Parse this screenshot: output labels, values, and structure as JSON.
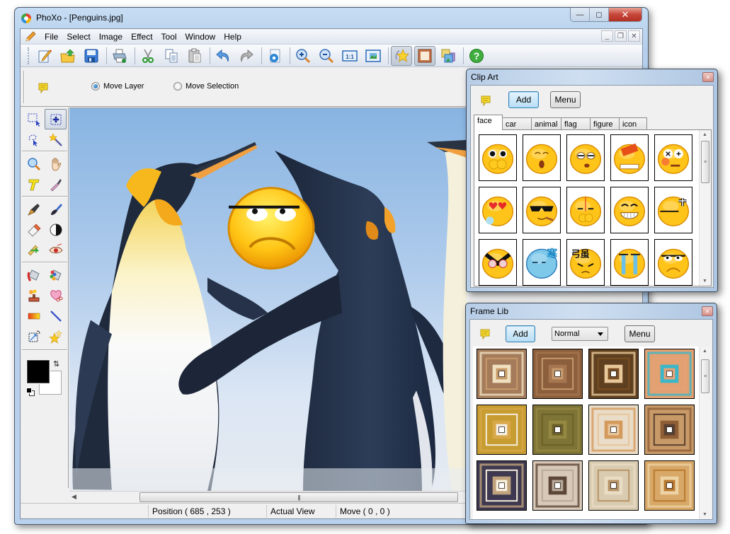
{
  "window": {
    "title": "PhoXo - [Penguins.jpg]",
    "caption": {
      "minimize": "—",
      "maximize": "◻",
      "close": "✕"
    },
    "mdi": {
      "minimize": "_",
      "restore": "❐",
      "close": "✕"
    }
  },
  "menubar": {
    "items": [
      {
        "label": "File"
      },
      {
        "label": "Select"
      },
      {
        "label": "Image"
      },
      {
        "label": "Effect"
      },
      {
        "label": "Tool"
      },
      {
        "label": "Window"
      },
      {
        "label": "Help"
      }
    ]
  },
  "toolbar": {
    "buttons": [
      {
        "name": "new",
        "icon": "new-document-icon"
      },
      {
        "name": "open",
        "icon": "open-folder-icon"
      },
      {
        "name": "save",
        "icon": "save-icon"
      },
      {
        "name": "print",
        "icon": "print-icon"
      },
      {
        "name": "cut",
        "icon": "cut-icon"
      },
      {
        "name": "copy",
        "icon": "copy-icon"
      },
      {
        "name": "paste",
        "icon": "paste-icon"
      },
      {
        "name": "undo",
        "icon": "undo-icon"
      },
      {
        "name": "redo",
        "icon": "redo-icon"
      },
      {
        "name": "settings",
        "icon": "document-settings-icon"
      },
      {
        "name": "zoom-in",
        "icon": "zoom-in-icon"
      },
      {
        "name": "zoom-out",
        "icon": "zoom-out-icon"
      },
      {
        "name": "actual-size",
        "icon": "actual-size-icon",
        "text": "1:1"
      },
      {
        "name": "fit-window",
        "icon": "fit-window-icon"
      },
      {
        "name": "clip-art",
        "icon": "clip-art-star-icon",
        "active": true
      },
      {
        "name": "frame-lib",
        "icon": "frame-icon",
        "active": true
      },
      {
        "name": "layers",
        "icon": "layers-icon"
      },
      {
        "name": "help",
        "icon": "help-icon",
        "text": "?"
      }
    ]
  },
  "options": {
    "radio_move_layer": "Move Layer",
    "radio_move_selection": "Move Selection",
    "selected": "Move Layer"
  },
  "tools": {
    "selected": "move-tool",
    "items": [
      "rect-select-tool",
      "move-tool",
      "lasso-select-tool",
      "magic-wand-tool",
      "zoom-tool",
      "hand-tool",
      "text-tool",
      "eyedropper-tool",
      "pen-tool",
      "brush-tool",
      "eraser-tool",
      "contrast-tool",
      "clone-tool",
      "red-eye-tool",
      "fill-tool",
      "color-replace-tool",
      "stamp-tool",
      "cutout-tool",
      "gradient-tool",
      "line-tool",
      "transform-tool",
      "star-shape-tool"
    ],
    "foreground_color": "#000000",
    "background_color": "#ffffff"
  },
  "canvas": {
    "image": "Penguins.jpg",
    "overlay": "sad-face-clipart"
  },
  "statusbar": {
    "position": "Position ( 685 , 253 )",
    "view": "Actual View",
    "move": "Move ( 0 , 0 )"
  },
  "clip_art": {
    "title": "Clip Art",
    "add_label": "Add",
    "menu_label": "Menu",
    "tabs": [
      "face",
      "car",
      "animal",
      "flag",
      "figure",
      "icon"
    ],
    "active_tab": "face",
    "items": [
      "surprised-face",
      "yawning-face",
      "sleepy-face",
      "brick-hit-face",
      "dizzy-face",
      "in-love-face",
      "cool-sunglasses-face",
      "sweating-face",
      "laughing-face",
      "angry-vein-face",
      "furious-face",
      "freezing-face",
      "fuming-face",
      "crying-face",
      "unimpressed-face"
    ]
  },
  "frame_lib": {
    "title": "Frame Lib",
    "add_label": "Add",
    "mode_select": "Normal",
    "menu_label": "Menu",
    "items": [
      {
        "name": "frame-1",
        "outer": "#a47c5b",
        "mid": "#f0e0c0",
        "inner": "#c89a6a"
      },
      {
        "name": "frame-2",
        "outer": "#8b5e3c",
        "mid": "#a67650",
        "inner": "#c79a6e"
      },
      {
        "name": "frame-3",
        "outer": "#5e4020",
        "mid": "#e8c89a",
        "inner": "#7a4e22"
      },
      {
        "name": "frame-4",
        "outer": "#e3a070",
        "mid": "#3bb7c9",
        "inner": "#e4a47a"
      },
      {
        "name": "frame-5",
        "outer": "#c79c30",
        "mid": "#d8a84a",
        "inner": "#f5eee0"
      },
      {
        "name": "frame-6",
        "outer": "#7d7436",
        "mid": "#958843",
        "inner": "#6c6028"
      },
      {
        "name": "frame-7",
        "outer": "#e9dcc8",
        "mid": "#d49a5c",
        "inner": "#e8c49a"
      },
      {
        "name": "frame-8",
        "outer": "#c89a68",
        "mid": "#8f5e36",
        "inner": "#5a4030"
      },
      {
        "name": "frame-9",
        "outer": "#3e3950",
        "mid": "#c0a27c",
        "inner": "#f8efdc"
      },
      {
        "name": "frame-10",
        "outer": "#d8c8b8",
        "mid": "#5c4636",
        "inner": "#b8a898"
      },
      {
        "name": "frame-11",
        "outer": "#d9cbb0",
        "mid": "#e8dcc4",
        "inner": "#b89468"
      },
      {
        "name": "frame-12",
        "outer": "#d8a868",
        "mid": "#ecd2a4",
        "inner": "#b8782e"
      }
    ]
  }
}
